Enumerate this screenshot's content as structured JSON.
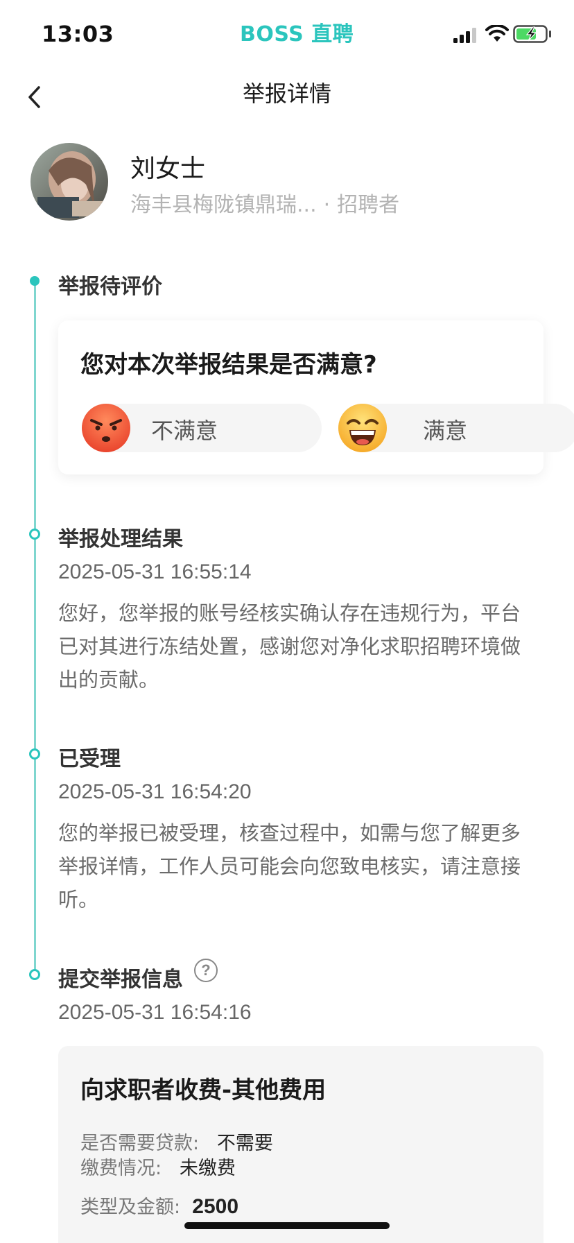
{
  "status_bar": {
    "time": "13:03",
    "brand": "BOSS 直聘"
  },
  "nav": {
    "title": "举报详情"
  },
  "profile": {
    "name": "刘女士",
    "company": "海丰县梅陇镇鼎瑞...",
    "separator": "·",
    "role": "招聘者"
  },
  "timeline": {
    "pending": {
      "title": "举报待评价",
      "question": "您对本次举报结果是否满意?",
      "dissatisfied_label": "不满意",
      "satisfied_label": "满意"
    },
    "result": {
      "title": "举报处理结果",
      "time": "2025-05-31 16:55:14",
      "body": "您好，您举报的账号经核实确认存在违规行为，平台已对其进行冻结处置，感谢您对净化求职招聘环境做出的贡献。"
    },
    "accepted": {
      "title": "已受理",
      "time": "2025-05-31 16:54:20",
      "body": "您的举报已被受理，核查过程中，如需与您了解更多举报详情，工作人员可能会向您致电核实，请注意接听。"
    },
    "submitted": {
      "title": "提交举报信息",
      "help": "?",
      "time": "2025-05-31 16:54:16"
    }
  },
  "report_info": {
    "title": "向求职者收费-其他费用",
    "loan_key": "是否需要贷款:",
    "loan_value": "不需要",
    "payment_key": "缴费情况:",
    "payment_value": "未缴费",
    "amount_key": "类型及金额:",
    "amount_value": "2500"
  },
  "colors": {
    "accent": "#2bc5bd",
    "timeline": "#7fd6cf"
  }
}
